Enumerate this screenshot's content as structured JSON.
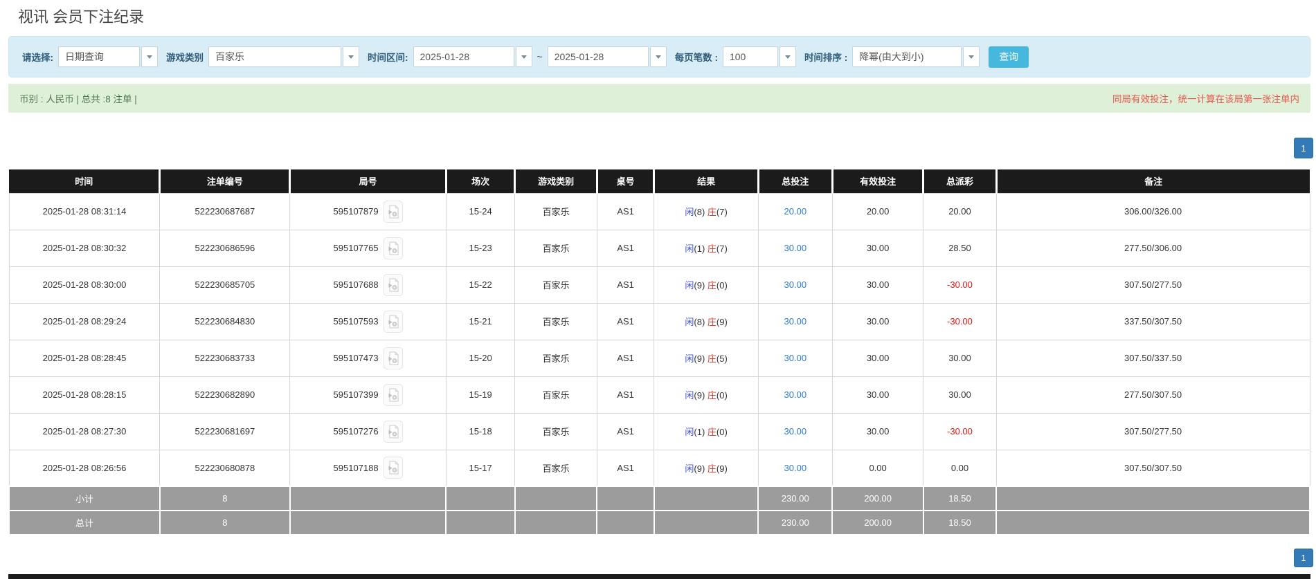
{
  "page": {
    "title": "视讯 会员下注纪录"
  },
  "colors": {
    "header_black": "#1b1b1b",
    "filter_bar_blue": "#d9edf7",
    "info_bar_green": "#dff0d8",
    "search_button_cyan": "#47b8dd",
    "pagination_blue": "#337ab7",
    "link_blue": "#2a7ad2",
    "player_blue": "#3f51d1",
    "banker_red": "#e03b30",
    "negative_red": "#f01010",
    "note_red": "#e8564b",
    "summary_gray": "#9c9c9c"
  },
  "filters": {
    "select_label": "请选择:",
    "select_value": "日期查询",
    "game_label": "游戏类别",
    "game_value": "百家乐",
    "range_label": "时间区间:",
    "date_from": "2025-01-28",
    "range_separator": "~",
    "date_to": "2025-01-28",
    "page_size_label": "每页笔数 :",
    "page_size_value": "100",
    "sort_label": "时间排序 :",
    "sort_value": "降幂(由大到小)",
    "search_button": "查询"
  },
  "info_bar": {
    "left": "币别 : 人民币 | 总共 :8 注单 |",
    "right": "同局有效投注，统一计算在该局第一张注单内"
  },
  "pagination": {
    "current_page": "1"
  },
  "table": {
    "headers": [
      "时间",
      "注单编号",
      "局号",
      "场次",
      "游戏类别",
      "桌号",
      "结果",
      "总投注",
      "有效投注",
      "总派彩",
      "备注"
    ],
    "video_icon": "video-replay-icon",
    "rows": [
      {
        "time": "2025-01-28 08:31:14",
        "bet_no": "522230687687",
        "round_no": "595107879",
        "session": "15-24",
        "game": "百家乐",
        "table_no": "AS1",
        "result_p": "闲",
        "result_p_n": "(8)",
        "result_b": "庄",
        "result_b_n": "(7)",
        "total_bet": "20.00",
        "valid_bet": "20.00",
        "payout": "20.00",
        "remark": "306.00/326.00"
      },
      {
        "time": "2025-01-28 08:30:32",
        "bet_no": "522230686596",
        "round_no": "595107765",
        "session": "15-23",
        "game": "百家乐",
        "table_no": "AS1",
        "result_p": "闲",
        "result_p_n": "(1)",
        "result_b": "庄",
        "result_b_n": "(7)",
        "total_bet": "30.00",
        "valid_bet": "30.00",
        "payout": "28.50",
        "remark": "277.50/306.00"
      },
      {
        "time": "2025-01-28 08:30:00",
        "bet_no": "522230685705",
        "round_no": "595107688",
        "session": "15-22",
        "game": "百家乐",
        "table_no": "AS1",
        "result_p": "闲",
        "result_p_n": "(9)",
        "result_b": "庄",
        "result_b_n": "(0)",
        "total_bet": "30.00",
        "valid_bet": "30.00",
        "payout": "-30.00",
        "remark": "307.50/277.50"
      },
      {
        "time": "2025-01-28 08:29:24",
        "bet_no": "522230684830",
        "round_no": "595107593",
        "session": "15-21",
        "game": "百家乐",
        "table_no": "AS1",
        "result_p": "闲",
        "result_p_n": "(8)",
        "result_b": "庄",
        "result_b_n": "(9)",
        "total_bet": "30.00",
        "valid_bet": "30.00",
        "payout": "-30.00",
        "remark": "337.50/307.50"
      },
      {
        "time": "2025-01-28 08:28:45",
        "bet_no": "522230683733",
        "round_no": "595107473",
        "session": "15-20",
        "game": "百家乐",
        "table_no": "AS1",
        "result_p": "闲",
        "result_p_n": "(9)",
        "result_b": "庄",
        "result_b_n": "(5)",
        "total_bet": "30.00",
        "valid_bet": "30.00",
        "payout": "30.00",
        "remark": "307.50/337.50"
      },
      {
        "time": "2025-01-28 08:28:15",
        "bet_no": "522230682890",
        "round_no": "595107399",
        "session": "15-19",
        "game": "百家乐",
        "table_no": "AS1",
        "result_p": "闲",
        "result_p_n": "(9)",
        "result_b": "庄",
        "result_b_n": "(0)",
        "total_bet": "30.00",
        "valid_bet": "30.00",
        "payout": "30.00",
        "remark": "277.50/307.50"
      },
      {
        "time": "2025-01-28 08:27:30",
        "bet_no": "522230681697",
        "round_no": "595107276",
        "session": "15-18",
        "game": "百家乐",
        "table_no": "AS1",
        "result_p": "闲",
        "result_p_n": "(1)",
        "result_b": "庄",
        "result_b_n": "(0)",
        "total_bet": "30.00",
        "valid_bet": "30.00",
        "payout": "-30.00",
        "remark": "307.50/277.50"
      },
      {
        "time": "2025-01-28 08:26:56",
        "bet_no": "522230680878",
        "round_no": "595107188",
        "session": "15-17",
        "game": "百家乐",
        "table_no": "AS1",
        "result_p": "闲",
        "result_p_n": "(9)",
        "result_b": "庄",
        "result_b_n": "(9)",
        "total_bet": "30.00",
        "valid_bet": "0.00",
        "payout": "0.00",
        "remark": "307.50/307.50"
      }
    ],
    "subtotal": {
      "label": "小计",
      "bet_count": "8",
      "total_bet": "230.00",
      "valid_bet": "200.00",
      "payout": "18.50"
    },
    "total": {
      "label": "总计",
      "bet_count": "8",
      "total_bet": "230.00",
      "valid_bet": "200.00",
      "payout": "18.50"
    }
  }
}
